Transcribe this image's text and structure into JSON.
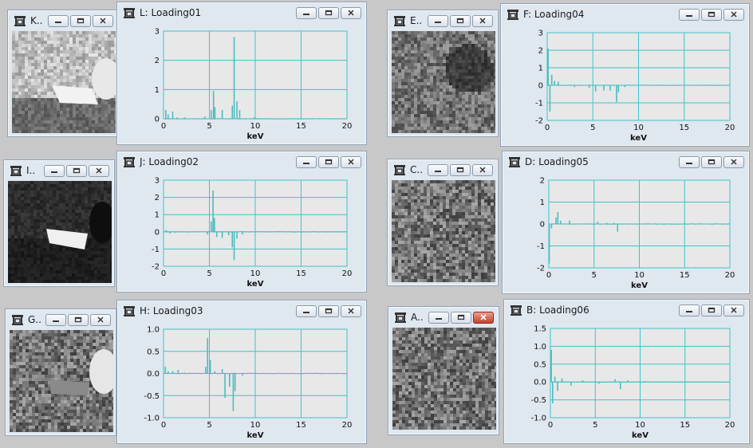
{
  "colors": {
    "plot_bg": "#e8e8e8",
    "grid": "#3cc4c8",
    "series": "#4cbcc0",
    "axis_text": "#111111"
  },
  "image_windows": [
    {
      "id": "win-k",
      "title": "K..",
      "texture": "bright"
    },
    {
      "id": "win-i",
      "title": "I..",
      "texture": "dark"
    },
    {
      "id": "win-g",
      "title": "G..",
      "texture": "particles"
    },
    {
      "id": "win-e",
      "title": "E..",
      "texture": "noise"
    },
    {
      "id": "win-c",
      "title": "C..",
      "texture": "noise"
    },
    {
      "id": "win-a",
      "title": "A..",
      "texture": "noise",
      "close_active": true
    }
  ],
  "plot_windows": [
    {
      "id": "win-l",
      "title": "L: Loading01"
    },
    {
      "id": "win-j",
      "title": "J: Loading02"
    },
    {
      "id": "win-h",
      "title": "H: Loading03"
    },
    {
      "id": "win-f",
      "title": "F: Loading04"
    },
    {
      "id": "win-d",
      "title": "D: Loading05"
    },
    {
      "id": "win-b",
      "title": "B: Loading06"
    }
  ],
  "chart_data": [
    {
      "type": "line",
      "name": "Loading01",
      "xlabel": "keV",
      "xlim": [
        0,
        20
      ],
      "ylim": [
        0,
        3
      ],
      "xticks": [
        "0",
        "5",
        "10",
        "15",
        "20"
      ],
      "yticks": [
        "3",
        "2",
        "1",
        "0"
      ],
      "peaks": [
        [
          0.25,
          0.3
        ],
        [
          0.5,
          0.15
        ],
        [
          1.0,
          0.25
        ],
        [
          1.5,
          0.05
        ],
        [
          2.3,
          0.05
        ],
        [
          4.5,
          0.08
        ],
        [
          5.2,
          0.3
        ],
        [
          5.45,
          0.95
        ],
        [
          5.6,
          0.4
        ],
        [
          6.4,
          0.3
        ],
        [
          7.5,
          0.45
        ],
        [
          7.7,
          2.8
        ],
        [
          8.0,
          0.6
        ],
        [
          8.3,
          0.3
        ],
        [
          9.9,
          0.05
        ]
      ]
    },
    {
      "type": "line",
      "name": "Loading02",
      "xlabel": "keV",
      "xlim": [
        0,
        20
      ],
      "ylim": [
        -2,
        3
      ],
      "xticks": [
        "0",
        "5",
        "10",
        "15",
        "20"
      ],
      "yticks": [
        "3",
        "2",
        "1",
        "0",
        "-1",
        "-2"
      ],
      "peaks": [
        [
          0.3,
          0.1
        ],
        [
          0.7,
          -0.1
        ],
        [
          1.3,
          -0.05
        ],
        [
          4.8,
          -0.15
        ],
        [
          5.2,
          0.6
        ],
        [
          5.4,
          2.4
        ],
        [
          5.55,
          0.8
        ],
        [
          5.8,
          -0.3
        ],
        [
          6.4,
          -0.35
        ],
        [
          7.1,
          -0.2
        ],
        [
          7.5,
          -0.9
        ],
        [
          7.7,
          -1.65
        ],
        [
          8.0,
          -0.4
        ],
        [
          8.6,
          -0.15
        ]
      ]
    },
    {
      "type": "line",
      "name": "Loading03",
      "xlabel": "keV",
      "xlim": [
        0,
        20
      ],
      "ylim": [
        -1,
        1
      ],
      "xticks": [
        "0",
        "5",
        "10",
        "15",
        "20"
      ],
      "yticks": [
        "1.0",
        "0.5",
        "0.0",
        "-0.5",
        "-1.0"
      ],
      "peaks": [
        [
          0.2,
          0.15
        ],
        [
          0.5,
          0.05
        ],
        [
          1.0,
          0.05
        ],
        [
          1.6,
          0.08
        ],
        [
          2.3,
          0.02
        ],
        [
          4.6,
          0.15
        ],
        [
          4.8,
          0.8
        ],
        [
          5.1,
          0.3
        ],
        [
          5.6,
          0.05
        ],
        [
          6.4,
          0.1
        ],
        [
          6.7,
          -0.55
        ],
        [
          7.2,
          -0.3
        ],
        [
          7.6,
          -0.85
        ],
        [
          7.8,
          -0.4
        ],
        [
          8.6,
          -0.05
        ],
        [
          16.5,
          0.01
        ]
      ]
    },
    {
      "type": "line",
      "name": "Loading04",
      "xlabel": "keV",
      "xlim": [
        0,
        20
      ],
      "ylim": [
        -2,
        3
      ],
      "xticks": [
        "0",
        "5",
        "10",
        "15",
        "20"
      ],
      "yticks": [
        "3",
        "2",
        "1",
        "0",
        "-1",
        "-2"
      ],
      "peaks": [
        [
          0.1,
          2.1
        ],
        [
          0.3,
          -1.5
        ],
        [
          0.5,
          0.6
        ],
        [
          0.8,
          0.25
        ],
        [
          1.2,
          0.2
        ],
        [
          3.0,
          -0.1
        ],
        [
          4.6,
          -0.15
        ],
        [
          5.3,
          -0.35
        ],
        [
          6.2,
          -0.3
        ],
        [
          6.9,
          -0.3
        ],
        [
          7.6,
          -0.95
        ],
        [
          7.8,
          -0.4
        ],
        [
          8.5,
          -0.1
        ]
      ]
    },
    {
      "type": "line",
      "name": "Loading05",
      "xlabel": "keV",
      "xlim": [
        0,
        20
      ],
      "ylim": [
        -2,
        2
      ],
      "xticks": [
        "0",
        "5",
        "10",
        "15",
        "20"
      ],
      "yticks": [
        "2",
        "1",
        "0",
        "-1",
        "-2"
      ],
      "peaks": [
        [
          0.05,
          -1.8
        ],
        [
          0.3,
          -0.2
        ],
        [
          0.8,
          0.3
        ],
        [
          1.0,
          0.55
        ],
        [
          1.3,
          0.15
        ],
        [
          2.3,
          0.15
        ],
        [
          5.4,
          0.1
        ],
        [
          6.4,
          0.05
        ],
        [
          7.2,
          0.05
        ],
        [
          7.6,
          -0.35
        ]
      ]
    },
    {
      "type": "line",
      "name": "Loading06",
      "xlabel": "keV",
      "xlim": [
        0,
        20
      ],
      "ylim": [
        -1,
        1.5
      ],
      "xticks": [
        "0",
        "5",
        "10",
        "15",
        "20"
      ],
      "yticks": [
        "1.5",
        "1.0",
        "0.5",
        "0.0",
        "-0.5",
        "-1.0"
      ],
      "peaks": [
        [
          0.1,
          0.9
        ],
        [
          0.25,
          -0.6
        ],
        [
          0.5,
          0.15
        ],
        [
          0.8,
          -0.25
        ],
        [
          1.3,
          0.1
        ],
        [
          2.3,
          -0.1
        ],
        [
          3.6,
          0.05
        ],
        [
          5.4,
          -0.05
        ],
        [
          7.2,
          0.08
        ],
        [
          7.8,
          -0.2
        ],
        [
          8.6,
          0.05
        ],
        [
          10.5,
          0.03
        ]
      ]
    }
  ]
}
